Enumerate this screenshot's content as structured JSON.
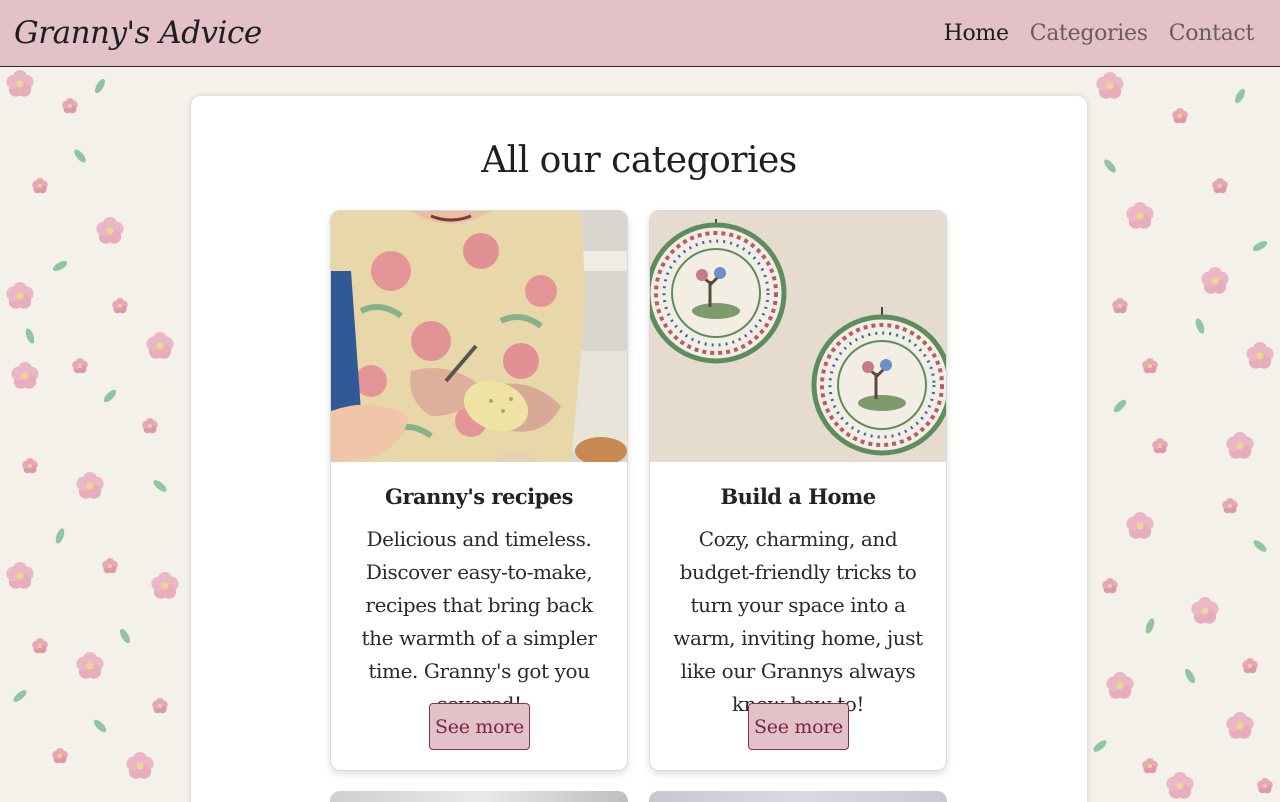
{
  "header": {
    "brand": "Granny's Advice",
    "nav": [
      {
        "label": "Home",
        "active": true
      },
      {
        "label": "Categories",
        "active": false
      },
      {
        "label": "Contact",
        "active": false
      }
    ]
  },
  "main": {
    "title": "All our categories",
    "cards": [
      {
        "title": "Granny's recipes",
        "text": "Delicious and timeless. Discover easy-to-make, recipes that bring back the warmth of a simpler time. Granny's got you covered!",
        "button": "See more",
        "image": "granny-peeling-potato"
      },
      {
        "title": "Build a Home",
        "text": "Cozy, charming, and budget-friendly tricks to turn your space into a warm, inviting home, just like our Grannys always knew how to!",
        "button": "See more",
        "image": "decorative-wall-plates"
      }
    ]
  },
  "colors": {
    "header_bg": "#e3c1c8",
    "button_bg": "#e3c1c8",
    "button_border": "#8c2d55",
    "button_text": "#7a2348"
  }
}
